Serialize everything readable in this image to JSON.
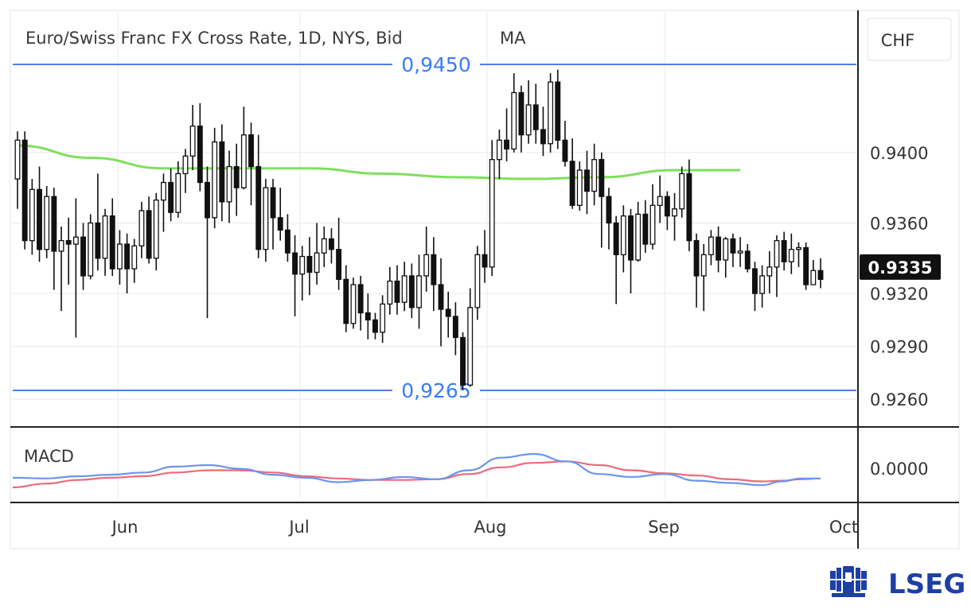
{
  "chart_data": {
    "type": "candlestick",
    "title": "Euro/Swiss Franc FX Cross Rate, 1D, NYS, Bid",
    "indicator_label": "MA",
    "currency": "CHF",
    "y_ticks": [
      "0.9400",
      "0.9360",
      "0.9320",
      "0.9290",
      "0.9260"
    ],
    "y_tick_values": [
      0.94,
      0.936,
      0.932,
      0.929,
      0.926
    ],
    "last_price_label": "0.9335",
    "last_price": 0.9335,
    "ylim": [
      0.924,
      0.947
    ],
    "x_labels": [
      "Jun",
      "Jul",
      "Aug",
      "Sep",
      "Oct"
    ],
    "levels": [
      {
        "label": "0,9450",
        "value": 0.945
      },
      {
        "label": "0,9265",
        "value": 0.9265
      }
    ],
    "candles": [
      [
        0.9385,
        0.9407,
        0.9412,
        0.9368
      ],
      [
        0.9407,
        0.935,
        0.9412,
        0.9345
      ],
      [
        0.935,
        0.9379,
        0.9385,
        0.9342
      ],
      [
        0.9379,
        0.9345,
        0.9392,
        0.9338
      ],
      [
        0.9345,
        0.9375,
        0.9381,
        0.934
      ],
      [
        0.9375,
        0.9344,
        0.938,
        0.9322
      ],
      [
        0.9344,
        0.935,
        0.9358,
        0.931
      ],
      [
        0.935,
        0.9348,
        0.9363,
        0.9325
      ],
      [
        0.9348,
        0.9352,
        0.9374,
        0.9295
      ],
      [
        0.9352,
        0.933,
        0.936,
        0.9322
      ],
      [
        0.933,
        0.936,
        0.9365,
        0.9328
      ],
      [
        0.936,
        0.934,
        0.9388,
        0.9333
      ],
      [
        0.934,
        0.9364,
        0.9368,
        0.933
      ],
      [
        0.9364,
        0.9334,
        0.9374,
        0.933
      ],
      [
        0.9334,
        0.9348,
        0.9356,
        0.9325
      ],
      [
        0.9348,
        0.9334,
        0.9354,
        0.932
      ],
      [
        0.9334,
        0.9347,
        0.9351,
        0.9326
      ],
      [
        0.9347,
        0.9367,
        0.9372,
        0.934
      ],
      [
        0.9367,
        0.934,
        0.9375,
        0.9337
      ],
      [
        0.934,
        0.9373,
        0.9377,
        0.9333
      ],
      [
        0.9373,
        0.9383,
        0.9388,
        0.9355
      ],
      [
        0.9383,
        0.9366,
        0.9391,
        0.9361
      ],
      [
        0.9366,
        0.9388,
        0.9395,
        0.9363
      ],
      [
        0.9388,
        0.9398,
        0.9402,
        0.9377
      ],
      [
        0.9398,
        0.9415,
        0.9427,
        0.939
      ],
      [
        0.9415,
        0.9383,
        0.9428,
        0.9378
      ],
      [
        0.9383,
        0.9363,
        0.9392,
        0.9306
      ],
      [
        0.9363,
        0.9406,
        0.9414,
        0.9357
      ],
      [
        0.9406,
        0.9372,
        0.9416,
        0.9361
      ],
      [
        0.9372,
        0.9392,
        0.9401,
        0.936
      ],
      [
        0.9392,
        0.938,
        0.9405,
        0.9364
      ],
      [
        0.938,
        0.941,
        0.9426,
        0.9379
      ],
      [
        0.941,
        0.9392,
        0.9417,
        0.937
      ],
      [
        0.9392,
        0.9345,
        0.941,
        0.934
      ],
      [
        0.9345,
        0.938,
        0.9385,
        0.9338
      ],
      [
        0.938,
        0.9363,
        0.9385,
        0.9345
      ],
      [
        0.9363,
        0.9356,
        0.938,
        0.935
      ],
      [
        0.9356,
        0.9343,
        0.9365,
        0.9338
      ],
      [
        0.9343,
        0.9331,
        0.9353,
        0.9307
      ],
      [
        0.9331,
        0.9341,
        0.9347,
        0.9316
      ],
      [
        0.9341,
        0.9332,
        0.9352,
        0.9319
      ],
      [
        0.9332,
        0.9343,
        0.936,
        0.9325
      ],
      [
        0.9343,
        0.9351,
        0.9358,
        0.9335
      ],
      [
        0.9351,
        0.9345,
        0.9357,
        0.9337
      ],
      [
        0.9345,
        0.9328,
        0.9363,
        0.9322
      ],
      [
        0.9328,
        0.9303,
        0.9336,
        0.9298
      ],
      [
        0.9303,
        0.9325,
        0.9329,
        0.93
      ],
      [
        0.9325,
        0.9309,
        0.933,
        0.9299
      ],
      [
        0.9309,
        0.9305,
        0.932,
        0.9294
      ],
      [
        0.9305,
        0.9298,
        0.9309,
        0.9294
      ],
      [
        0.9298,
        0.9314,
        0.9319,
        0.9292
      ],
      [
        0.9314,
        0.9327,
        0.9335,
        0.9308
      ],
      [
        0.9327,
        0.9315,
        0.9336,
        0.9308
      ],
      [
        0.9315,
        0.933,
        0.9338,
        0.931
      ],
      [
        0.933,
        0.9312,
        0.9337,
        0.9306
      ],
      [
        0.9312,
        0.933,
        0.9342,
        0.93
      ],
      [
        0.933,
        0.9342,
        0.9358,
        0.9321
      ],
      [
        0.9342,
        0.9325,
        0.9352,
        0.931
      ],
      [
        0.9325,
        0.9311,
        0.934,
        0.929
      ],
      [
        0.9311,
        0.9307,
        0.9321,
        0.9295
      ],
      [
        0.9307,
        0.9295,
        0.9315,
        0.9285
      ],
      [
        0.9295,
        0.9268,
        0.9298,
        0.9265
      ],
      [
        0.9268,
        0.9312,
        0.9323,
        0.9267
      ],
      [
        0.9312,
        0.9342,
        0.9347,
        0.9305
      ],
      [
        0.9342,
        0.9335,
        0.9356,
        0.9326
      ],
      [
        0.9335,
        0.9396,
        0.9407,
        0.933
      ],
      [
        0.9396,
        0.9407,
        0.9413,
        0.9385
      ],
      [
        0.9407,
        0.9402,
        0.9425,
        0.9395
      ],
      [
        0.9402,
        0.9434,
        0.9445,
        0.94
      ],
      [
        0.9434,
        0.941,
        0.9438,
        0.94
      ],
      [
        0.941,
        0.9427,
        0.9441,
        0.9405
      ],
      [
        0.9427,
        0.9413,
        0.9439,
        0.9405
      ],
      [
        0.9413,
        0.9405,
        0.9426,
        0.9398
      ],
      [
        0.9405,
        0.944,
        0.9445,
        0.94
      ],
      [
        0.944,
        0.9407,
        0.9447,
        0.9402
      ],
      [
        0.9407,
        0.9395,
        0.9418,
        0.9392
      ],
      [
        0.9395,
        0.937,
        0.9408,
        0.9368
      ],
      [
        0.937,
        0.939,
        0.9395,
        0.9367
      ],
      [
        0.939,
        0.9378,
        0.9401,
        0.9365
      ],
      [
        0.9378,
        0.9396,
        0.9405,
        0.937
      ],
      [
        0.9396,
        0.9375,
        0.94,
        0.9346
      ],
      [
        0.9375,
        0.936,
        0.938,
        0.9345
      ],
      [
        0.936,
        0.9342,
        0.9364,
        0.9314
      ],
      [
        0.9342,
        0.9364,
        0.937,
        0.9332
      ],
      [
        0.9364,
        0.9339,
        0.9368,
        0.932
      ],
      [
        0.9339,
        0.9365,
        0.9372,
        0.9338
      ],
      [
        0.9365,
        0.9348,
        0.9373,
        0.9343
      ],
      [
        0.9348,
        0.937,
        0.9382,
        0.9345
      ],
      [
        0.937,
        0.9375,
        0.9387,
        0.936
      ],
      [
        0.9375,
        0.9364,
        0.9378,
        0.9356
      ],
      [
        0.9364,
        0.9368,
        0.9377,
        0.935
      ],
      [
        0.9368,
        0.9388,
        0.9392,
        0.9363
      ],
      [
        0.9388,
        0.935,
        0.9396,
        0.9344
      ],
      [
        0.935,
        0.933,
        0.9354,
        0.9312
      ],
      [
        0.933,
        0.9342,
        0.9348,
        0.931
      ],
      [
        0.9342,
        0.9352,
        0.9356,
        0.9336
      ],
      [
        0.9352,
        0.9339,
        0.9358,
        0.9332
      ],
      [
        0.9339,
        0.9351,
        0.9352,
        0.9329
      ],
      [
        0.9351,
        0.9343,
        0.9354,
        0.9335
      ],
      [
        0.9343,
        0.9344,
        0.9352,
        0.9335
      ],
      [
        0.9344,
        0.9334,
        0.9348,
        0.9332
      ],
      [
        0.9334,
        0.932,
        0.9338,
        0.931
      ],
      [
        0.932,
        0.933,
        0.9336,
        0.9312
      ],
      [
        0.933,
        0.9335,
        0.9344,
        0.932
      ],
      [
        0.9335,
        0.935,
        0.9353,
        0.9318
      ],
      [
        0.935,
        0.9338,
        0.9355,
        0.9333
      ],
      [
        0.9338,
        0.9345,
        0.9354,
        0.9331
      ],
      [
        0.9345,
        0.9346,
        0.9349,
        0.9335
      ],
      [
        0.9346,
        0.9325,
        0.9349,
        0.9322
      ],
      [
        0.9325,
        0.9333,
        0.9339,
        0.9325
      ],
      [
        0.9333,
        0.9328,
        0.934,
        0.9323
      ]
    ],
    "moving_average": [
      [
        0,
        0.9404
      ],
      [
        10,
        0.9397
      ],
      [
        20,
        0.9391
      ],
      [
        30,
        0.9391
      ],
      [
        40,
        0.9391
      ],
      [
        50,
        0.9388
      ],
      [
        60,
        0.9386
      ],
      [
        70,
        0.9385
      ],
      [
        80,
        0.9386
      ],
      [
        90,
        0.939
      ],
      [
        99,
        0.939
      ]
    ],
    "macd_label": "MACD",
    "macd_tick_label": "0.0000",
    "macd_range": [
      -0.002,
      0.003
    ],
    "macd": [
      [
        0,
        -0.0002
      ],
      [
        5,
        -0.0003
      ],
      [
        10,
        0.0
      ],
      [
        15,
        0.0002
      ],
      [
        20,
        0.0005
      ],
      [
        25,
        0.0013
      ],
      [
        30,
        0.0015
      ],
      [
        35,
        0.001
      ],
      [
        40,
        0.0002
      ],
      [
        45,
        -0.0002
      ],
      [
        50,
        -0.0008
      ],
      [
        55,
        -0.0005
      ],
      [
        60,
        -0.0001
      ],
      [
        65,
        -0.0004
      ],
      [
        70,
        0.0008
      ],
      [
        75,
        0.0025
      ],
      [
        80,
        0.003
      ],
      [
        85,
        0.002
      ],
      [
        90,
        0.0003
      ],
      [
        95,
        -0.0001
      ],
      [
        100,
        0.0003
      ],
      [
        105,
        -0.0006
      ],
      [
        110,
        -0.0009
      ],
      [
        115,
        -0.0012
      ],
      [
        118,
        -0.0007
      ],
      [
        121,
        -0.0003
      ],
      [
        124,
        -0.0003
      ]
    ],
    "macd_signal": [
      [
        0,
        -0.0015
      ],
      [
        5,
        -0.001
      ],
      [
        10,
        -0.0005
      ],
      [
        15,
        -0.0002
      ],
      [
        20,
        0.0
      ],
      [
        25,
        0.0005
      ],
      [
        30,
        0.0008
      ],
      [
        35,
        0.0008
      ],
      [
        40,
        0.0005
      ],
      [
        45,
        0.0
      ],
      [
        50,
        -0.0003
      ],
      [
        55,
        -0.0005
      ],
      [
        60,
        -0.0005
      ],
      [
        65,
        -0.0004
      ],
      [
        70,
        0.0003
      ],
      [
        75,
        0.0012
      ],
      [
        80,
        0.0018
      ],
      [
        85,
        0.002
      ],
      [
        90,
        0.0015
      ],
      [
        95,
        0.0008
      ],
      [
        100,
        0.0004
      ],
      [
        105,
        0.0001
      ],
      [
        110,
        -0.0004
      ],
      [
        115,
        -0.0007
      ],
      [
        118,
        -0.0006
      ],
      [
        121,
        -0.0004
      ],
      [
        124,
        -0.0003
      ]
    ]
  },
  "branding": {
    "logo_text": "LSEG"
  },
  "colors": {
    "level_line": "#4a7fe8",
    "level_label": "#3b7cf5",
    "moving_average": "#7ee05e",
    "macd": "#6b95ec",
    "macd_signal": "#ec6a78",
    "candle": "#111111",
    "last_price_bg": "#111111",
    "logo": "#1c3fa8",
    "grid": "#ebebeb",
    "axis_line": "#222222"
  }
}
